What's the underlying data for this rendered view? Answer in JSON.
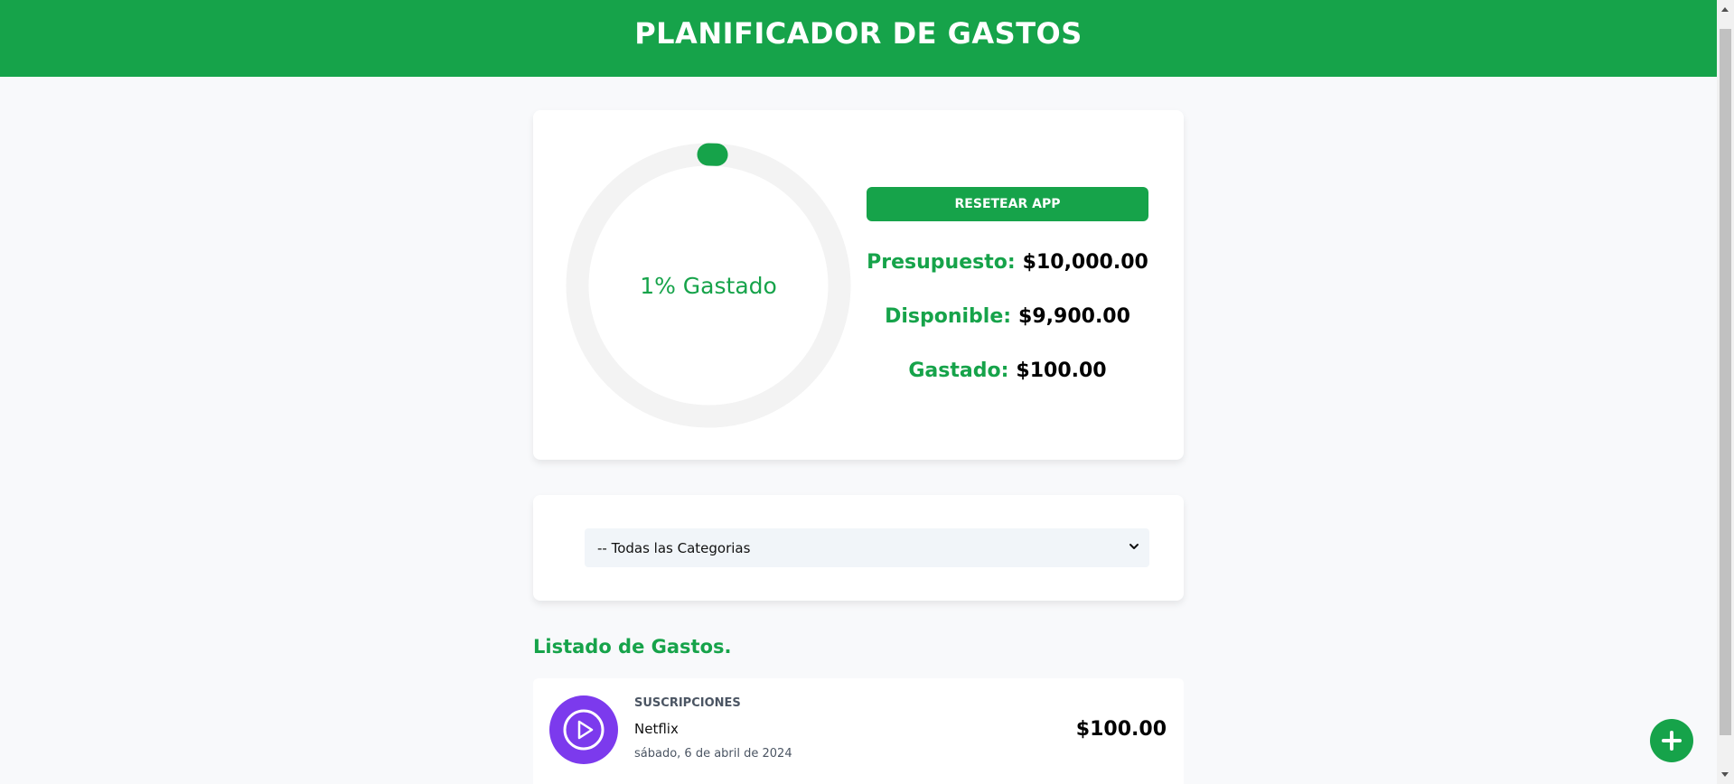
{
  "app": {
    "title": "PLANIFICADOR DE GASTOS",
    "accent_color": "#16a34a"
  },
  "budget": {
    "reset_label": "RESETEAR APP",
    "progress_percent": 1,
    "progress_label": "1% Gastado",
    "stats": [
      {
        "label": "Presupuesto:",
        "value": "$10,000.00"
      },
      {
        "label": "Disponible:",
        "value": "$9,900.00"
      },
      {
        "label": "Gastado:",
        "value": "$100.00"
      }
    ]
  },
  "filter": {
    "selected": "-- Todas las Categorias",
    "icon": "chevron-down-icon"
  },
  "expenses": {
    "title": "Listado de Gastos.",
    "items": [
      {
        "category": "SUSCRIPCIONES",
        "name": "Netflix",
        "date": "sábado, 6 de abril de 2024",
        "amount": "$100.00",
        "icon": "play-icon",
        "icon_color": "#7c3aed"
      }
    ]
  },
  "fab": {
    "icon": "plus-icon"
  }
}
